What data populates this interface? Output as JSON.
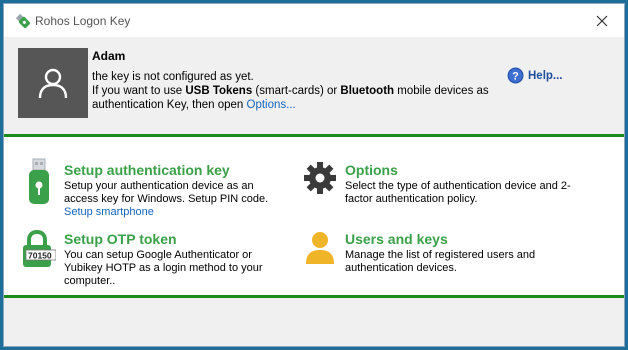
{
  "window": {
    "title": "Rohos Logon Key"
  },
  "header": {
    "user_name": "Adam",
    "line1": "the key is not configured as yet.",
    "line2_pre": "If you want to use ",
    "line2_bold1": "USB Tokens",
    "line2_mid": " (smart-cards) or ",
    "line2_bold2": "Bluetooth",
    "line2_post": " mobile devices as authentication Key, then open ",
    "options_link": "Options...",
    "help_label": "Help..."
  },
  "tiles": {
    "setup_key": {
      "title": "Setup authentication key",
      "desc": "Setup your authentication device as an access key for Windows. Setup PIN code. ",
      "link": "Setup smartphone"
    },
    "options": {
      "title": "Options",
      "desc": "Select the type of authentication device and 2-factor authentication policy."
    },
    "otp": {
      "title": "Setup OTP token",
      "desc": "You can setup Google Authenticator or Yubikey HOTP as a login method to your computer..",
      "icon_text": "70150"
    },
    "users": {
      "title": "Users and keys",
      "desc": "Manage the list of registered users and authentication devices."
    }
  },
  "colors": {
    "accent_green": "#3aa049",
    "divider_green": "#1d8a1d",
    "link_blue": "#1565c0",
    "avatar_bg": "#565656",
    "user_icon": "#f0b429"
  }
}
